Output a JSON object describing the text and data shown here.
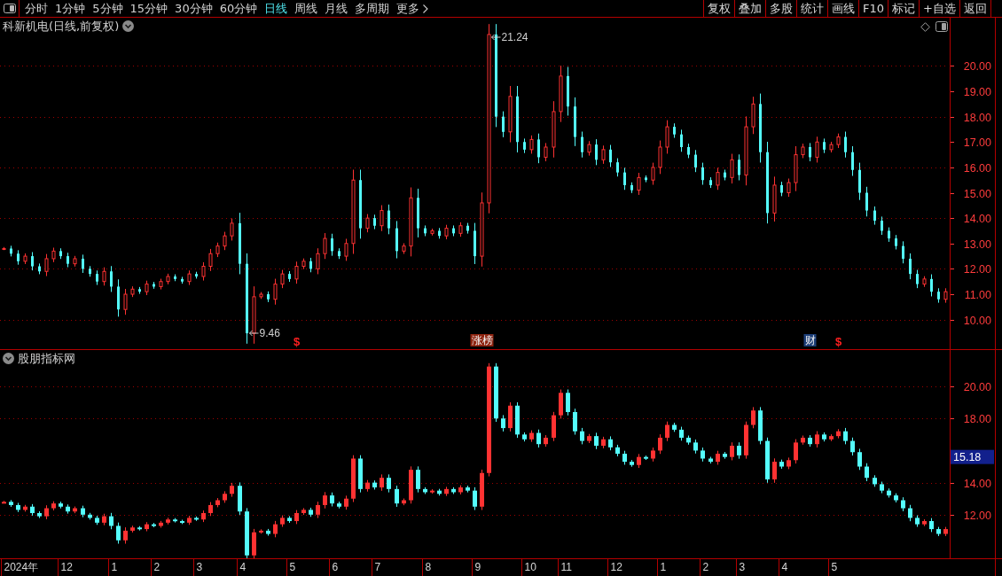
{
  "toolbar": {
    "periods": [
      {
        "label": "分时",
        "selected": false
      },
      {
        "label": "1分钟",
        "selected": false
      },
      {
        "label": "5分钟",
        "selected": false
      },
      {
        "label": "15分钟",
        "selected": false
      },
      {
        "label": "30分钟",
        "selected": false
      },
      {
        "label": "60分钟",
        "selected": false
      },
      {
        "label": "日线",
        "selected": true
      },
      {
        "label": "周线",
        "selected": false
      },
      {
        "label": "月线",
        "selected": false
      },
      {
        "label": "多周期",
        "selected": false
      }
    ],
    "more_menu": {
      "label": "更多"
    },
    "actions": [
      "复权",
      "叠加",
      "多股",
      "统计",
      "画线",
      "F10",
      "标记",
      "+自选",
      "返回"
    ]
  },
  "price_panel": {
    "title": "科新机电(日线,前复权)",
    "y_axis": [
      "20.00",
      "19.00",
      "18.00",
      "17.00",
      "16.00",
      "15.00",
      "14.00",
      "13.00",
      "12.00",
      "11.00",
      "10.00"
    ],
    "annotations": [
      "21.24",
      "9.46"
    ],
    "events": [
      {
        "kind": "dividend",
        "text": "$"
      },
      {
        "kind": "tag",
        "text": "涨榜",
        "color": "#8e2410"
      },
      {
        "kind": "tag",
        "text": "财",
        "color": "#1c3e78"
      },
      {
        "kind": "dividend",
        "text": "$"
      }
    ]
  },
  "indicator_panel": {
    "title": "股朋指标网",
    "y_axis": [
      "20.00",
      "18.00",
      "14.00",
      "12.00"
    ],
    "current_value": "15.18"
  },
  "date_axis": [
    "2024年",
    "12",
    "1",
    "2",
    "3",
    "4",
    "5",
    "6",
    "7",
    "8",
    "9",
    "10",
    "11",
    "12",
    "1",
    "2",
    "3",
    "4",
    "5"
  ]
}
